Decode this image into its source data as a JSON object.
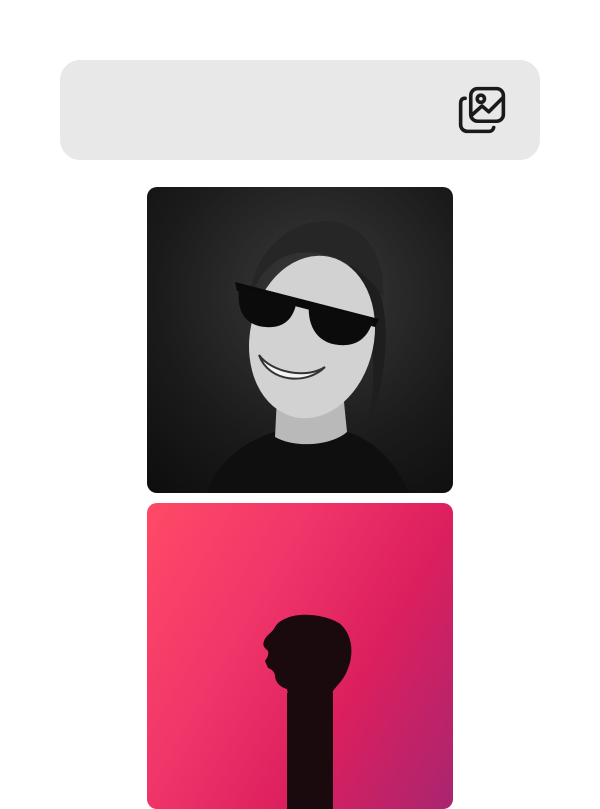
{
  "toolbar": {
    "gallery_icon": "images-gallery-icon"
  },
  "photos": [
    {
      "subject": "smiling-woman-with-sunglasses",
      "style": "black-and-white"
    },
    {
      "subject": "silhouette-profile",
      "style": "pink-gradient"
    }
  ],
  "colors": {
    "toolbar_bg": "#e8e8e8",
    "icon": "#1a1a1a",
    "photo2_start": "#ff4a66",
    "photo2_end": "#a92570"
  }
}
